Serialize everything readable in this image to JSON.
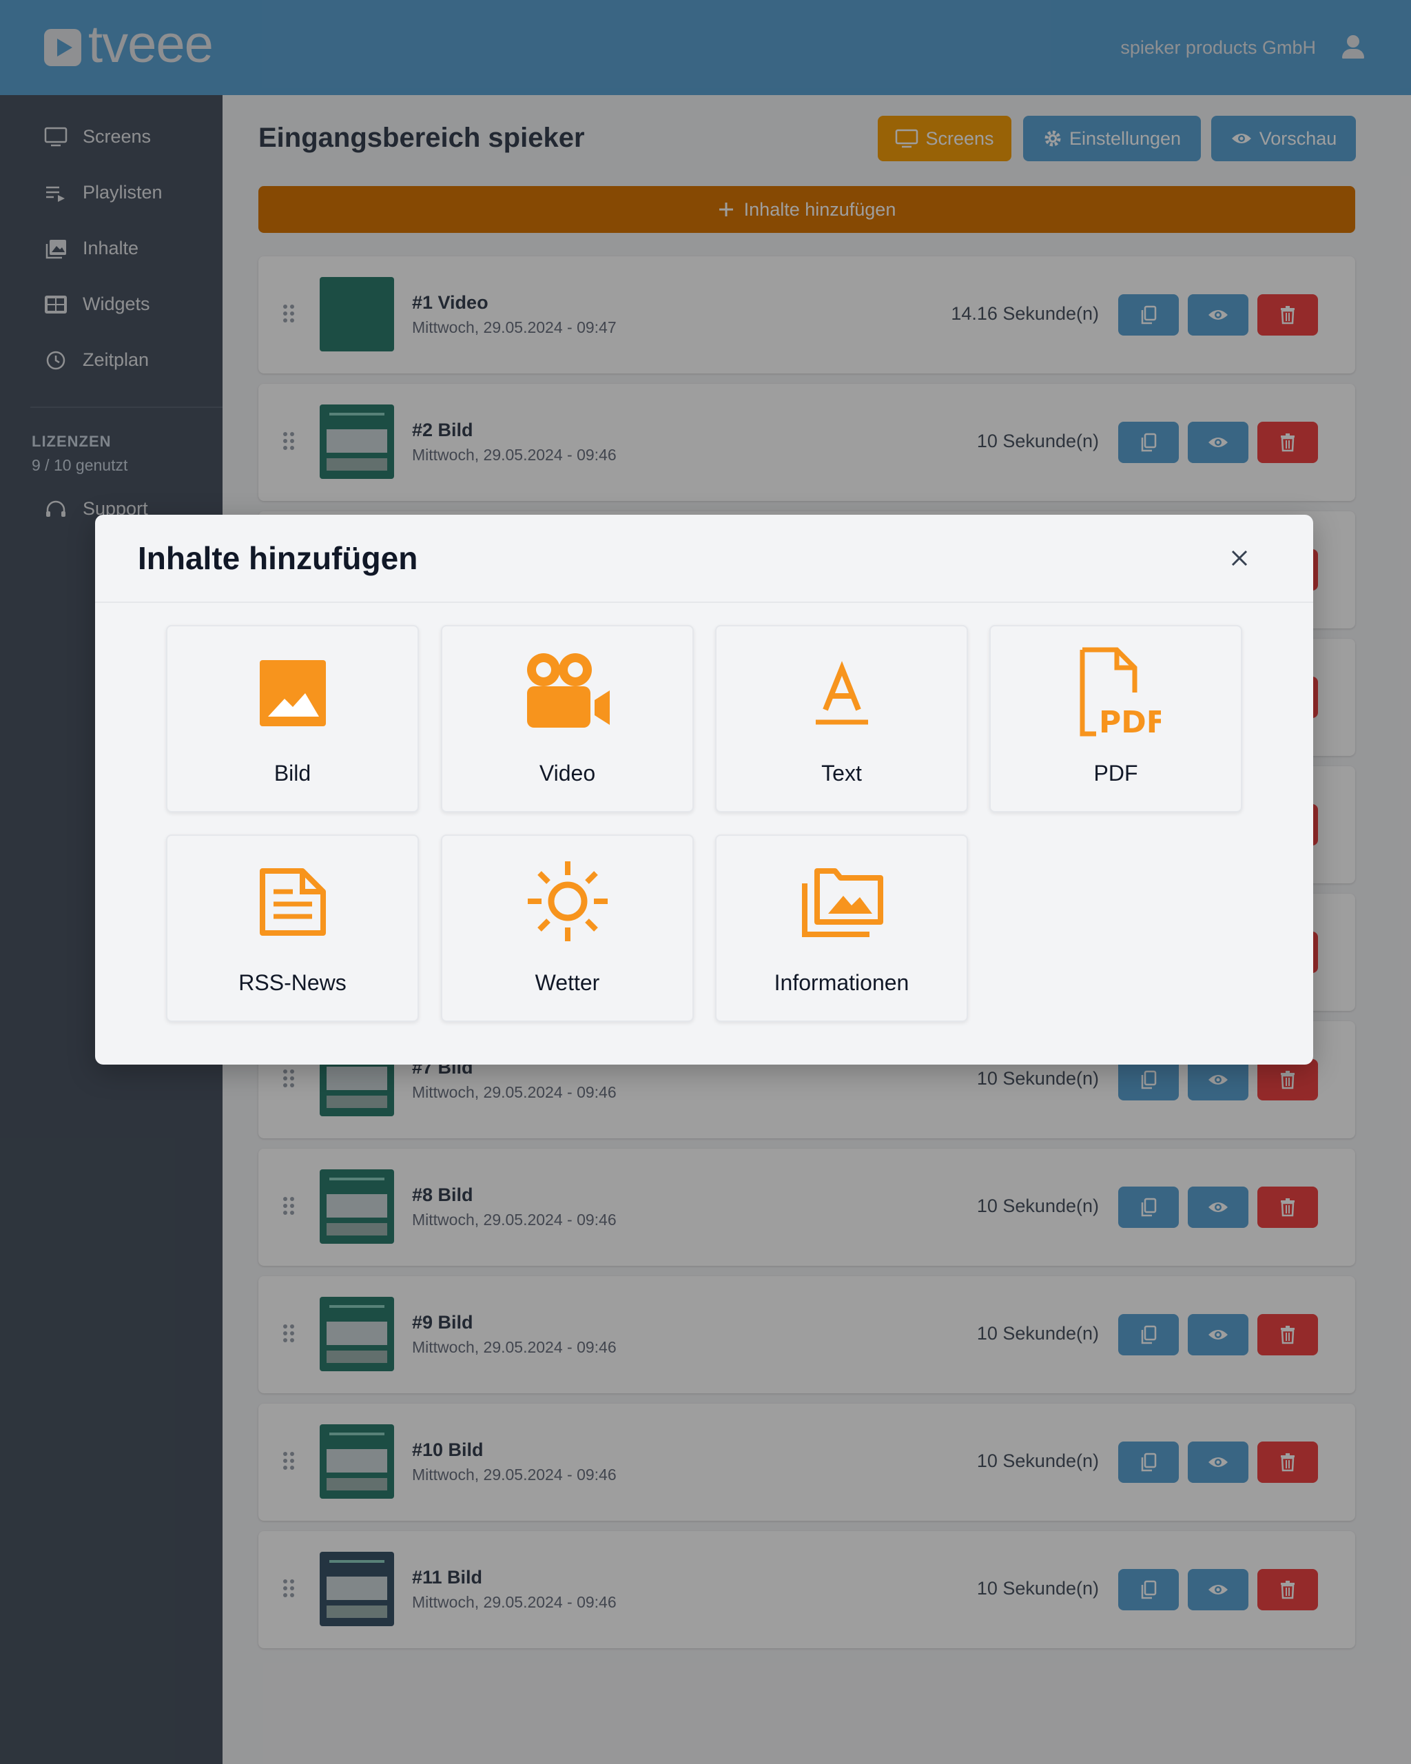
{
  "header": {
    "logo_text": "tveee",
    "company": "spieker products GmbH"
  },
  "sidebar": {
    "items": [
      {
        "label": "Screens",
        "icon": "monitor-icon"
      },
      {
        "label": "Playlisten",
        "icon": "playlist-icon"
      },
      {
        "label": "Inhalte",
        "icon": "images-icon"
      },
      {
        "label": "Widgets",
        "icon": "widgets-icon"
      },
      {
        "label": "Zeitplan",
        "icon": "clock-icon"
      }
    ],
    "licenses_title": "LIZENZEN",
    "licenses_count": "9 / 10 genutzt",
    "support": "Support"
  },
  "main": {
    "title": "Eingangsbereich spieker",
    "buttons": {
      "screens": "Screens",
      "settings": "Einstellungen",
      "preview": "Vorschau"
    },
    "add_content": "Inhalte hinzufügen",
    "rows": [
      {
        "title": "#1 Video",
        "date": "Mittwoch, 29.05.2024 - 09:47",
        "duration": "14.16 Sekunde(n)"
      },
      {
        "title": "#2 Bild",
        "date": "Mittwoch, 29.05.2024 - 09:46",
        "duration": "10 Sekunde(n)"
      },
      {
        "title": "#7 Bild",
        "date": "Mittwoch, 29.05.2024 - 09:46",
        "duration": "10 Sekunde(n)"
      },
      {
        "title": "#8 Bild",
        "date": "Mittwoch, 29.05.2024 - 09:46",
        "duration": "10 Sekunde(n)"
      },
      {
        "title": "#9 Bild",
        "date": "Mittwoch, 29.05.2024 - 09:46",
        "duration": "10 Sekunde(n)"
      },
      {
        "title": "#10 Bild",
        "date": "Mittwoch, 29.05.2024 - 09:46",
        "duration": "10 Sekunde(n)"
      },
      {
        "title": "#11 Bild",
        "date": "Mittwoch, 29.05.2024 - 09:46",
        "duration": "10 Sekunde(n)"
      }
    ]
  },
  "modal": {
    "title": "Inhalte hinzufügen",
    "cards": [
      {
        "label": "Bild",
        "icon": "image-icon"
      },
      {
        "label": "Video",
        "icon": "video-camera-icon"
      },
      {
        "label": "Text",
        "icon": "text-icon"
      },
      {
        "label": "PDF",
        "icon": "pdf-file-icon"
      },
      {
        "label": "RSS-News",
        "icon": "news-document-icon"
      },
      {
        "label": "Wetter",
        "icon": "sun-icon"
      },
      {
        "label": "Informationen",
        "icon": "photo-folder-icon"
      }
    ]
  },
  "colors": {
    "header": "#5da3d4",
    "sidebar": "#4b5563",
    "accent_orange": "#f59e0b",
    "add_bar": "#d97706",
    "blue_button": "#5da3d4",
    "delete_button": "#ef4444",
    "modal_icon": "#f7941d"
  }
}
